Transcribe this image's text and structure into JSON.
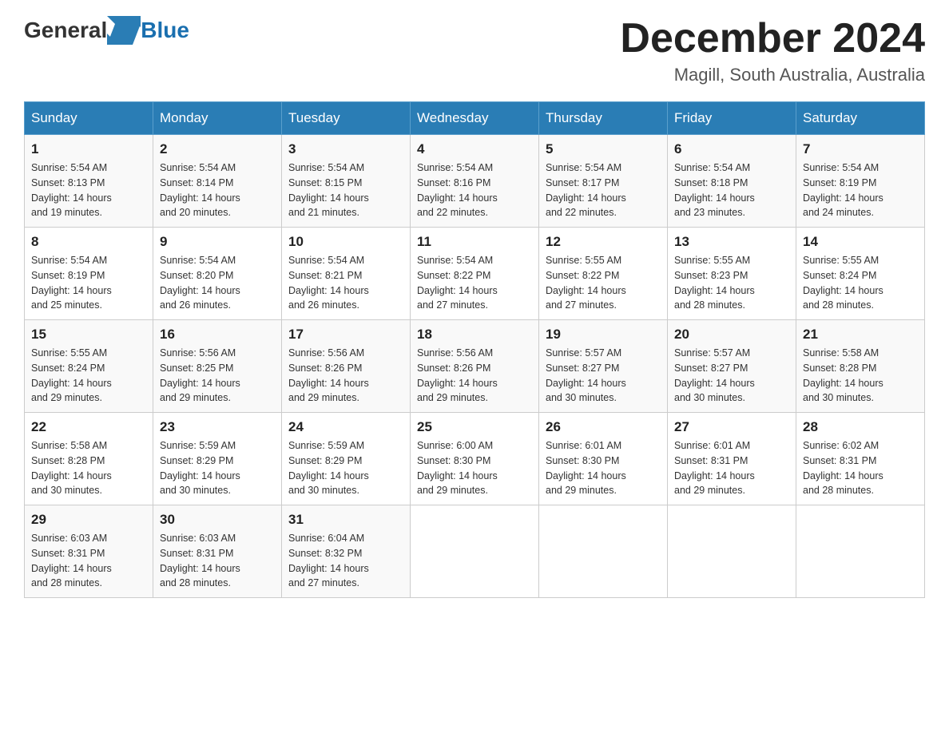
{
  "logo": {
    "general": "General",
    "blue": "Blue"
  },
  "title": "December 2024",
  "subtitle": "Magill, South Australia, Australia",
  "days_of_week": [
    "Sunday",
    "Monday",
    "Tuesday",
    "Wednesday",
    "Thursday",
    "Friday",
    "Saturday"
  ],
  "weeks": [
    [
      {
        "day": "1",
        "sunrise": "5:54 AM",
        "sunset": "8:13 PM",
        "daylight": "14 hours and 19 minutes."
      },
      {
        "day": "2",
        "sunrise": "5:54 AM",
        "sunset": "8:14 PM",
        "daylight": "14 hours and 20 minutes."
      },
      {
        "day": "3",
        "sunrise": "5:54 AM",
        "sunset": "8:15 PM",
        "daylight": "14 hours and 21 minutes."
      },
      {
        "day": "4",
        "sunrise": "5:54 AM",
        "sunset": "8:16 PM",
        "daylight": "14 hours and 22 minutes."
      },
      {
        "day": "5",
        "sunrise": "5:54 AM",
        "sunset": "8:17 PM",
        "daylight": "14 hours and 22 minutes."
      },
      {
        "day": "6",
        "sunrise": "5:54 AM",
        "sunset": "8:18 PM",
        "daylight": "14 hours and 23 minutes."
      },
      {
        "day": "7",
        "sunrise": "5:54 AM",
        "sunset": "8:19 PM",
        "daylight": "14 hours and 24 minutes."
      }
    ],
    [
      {
        "day": "8",
        "sunrise": "5:54 AM",
        "sunset": "8:19 PM",
        "daylight": "14 hours and 25 minutes."
      },
      {
        "day": "9",
        "sunrise": "5:54 AM",
        "sunset": "8:20 PM",
        "daylight": "14 hours and 26 minutes."
      },
      {
        "day": "10",
        "sunrise": "5:54 AM",
        "sunset": "8:21 PM",
        "daylight": "14 hours and 26 minutes."
      },
      {
        "day": "11",
        "sunrise": "5:54 AM",
        "sunset": "8:22 PM",
        "daylight": "14 hours and 27 minutes."
      },
      {
        "day": "12",
        "sunrise": "5:55 AM",
        "sunset": "8:22 PM",
        "daylight": "14 hours and 27 minutes."
      },
      {
        "day": "13",
        "sunrise": "5:55 AM",
        "sunset": "8:23 PM",
        "daylight": "14 hours and 28 minutes."
      },
      {
        "day": "14",
        "sunrise": "5:55 AM",
        "sunset": "8:24 PM",
        "daylight": "14 hours and 28 minutes."
      }
    ],
    [
      {
        "day": "15",
        "sunrise": "5:55 AM",
        "sunset": "8:24 PM",
        "daylight": "14 hours and 29 minutes."
      },
      {
        "day": "16",
        "sunrise": "5:56 AM",
        "sunset": "8:25 PM",
        "daylight": "14 hours and 29 minutes."
      },
      {
        "day": "17",
        "sunrise": "5:56 AM",
        "sunset": "8:26 PM",
        "daylight": "14 hours and 29 minutes."
      },
      {
        "day": "18",
        "sunrise": "5:56 AM",
        "sunset": "8:26 PM",
        "daylight": "14 hours and 29 minutes."
      },
      {
        "day": "19",
        "sunrise": "5:57 AM",
        "sunset": "8:27 PM",
        "daylight": "14 hours and 30 minutes."
      },
      {
        "day": "20",
        "sunrise": "5:57 AM",
        "sunset": "8:27 PM",
        "daylight": "14 hours and 30 minutes."
      },
      {
        "day": "21",
        "sunrise": "5:58 AM",
        "sunset": "8:28 PM",
        "daylight": "14 hours and 30 minutes."
      }
    ],
    [
      {
        "day": "22",
        "sunrise": "5:58 AM",
        "sunset": "8:28 PM",
        "daylight": "14 hours and 30 minutes."
      },
      {
        "day": "23",
        "sunrise": "5:59 AM",
        "sunset": "8:29 PM",
        "daylight": "14 hours and 30 minutes."
      },
      {
        "day": "24",
        "sunrise": "5:59 AM",
        "sunset": "8:29 PM",
        "daylight": "14 hours and 30 minutes."
      },
      {
        "day": "25",
        "sunrise": "6:00 AM",
        "sunset": "8:30 PM",
        "daylight": "14 hours and 29 minutes."
      },
      {
        "day": "26",
        "sunrise": "6:01 AM",
        "sunset": "8:30 PM",
        "daylight": "14 hours and 29 minutes."
      },
      {
        "day": "27",
        "sunrise": "6:01 AM",
        "sunset": "8:31 PM",
        "daylight": "14 hours and 29 minutes."
      },
      {
        "day": "28",
        "sunrise": "6:02 AM",
        "sunset": "8:31 PM",
        "daylight": "14 hours and 28 minutes."
      }
    ],
    [
      {
        "day": "29",
        "sunrise": "6:03 AM",
        "sunset": "8:31 PM",
        "daylight": "14 hours and 28 minutes."
      },
      {
        "day": "30",
        "sunrise": "6:03 AM",
        "sunset": "8:31 PM",
        "daylight": "14 hours and 28 minutes."
      },
      {
        "day": "31",
        "sunrise": "6:04 AM",
        "sunset": "8:32 PM",
        "daylight": "14 hours and 27 minutes."
      },
      null,
      null,
      null,
      null
    ]
  ],
  "labels": {
    "sunrise": "Sunrise:",
    "sunset": "Sunset:",
    "daylight": "Daylight:"
  }
}
